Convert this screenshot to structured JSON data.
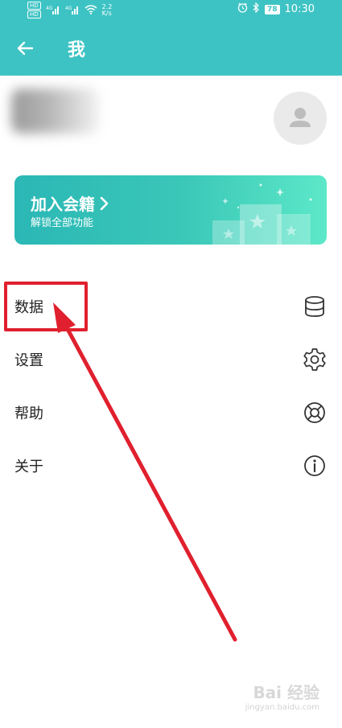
{
  "status_bar": {
    "net_label_1": "HD",
    "net_label_2": "HD",
    "sig_1": "4G",
    "sig_2": "4G",
    "speed_value": "2.2",
    "speed_unit": "K/s",
    "battery": "78",
    "time": "10:30"
  },
  "app_bar": {
    "title": "我",
    "back_icon": "arrow-left-icon"
  },
  "member_card": {
    "title": "加入会籍",
    "subtitle": "解锁全部功能"
  },
  "menu": {
    "items": [
      {
        "label": "数据",
        "icon": "database-icon"
      },
      {
        "label": "设置",
        "icon": "gear-icon"
      },
      {
        "label": "帮助",
        "icon": "lifebuoy-icon"
      },
      {
        "label": "关于",
        "icon": "info-icon"
      }
    ]
  },
  "watermark": {
    "brand": "Bai 经验",
    "url": "jingyan.baidu.com"
  },
  "colors": {
    "primary": "#3ec3c4",
    "annotation": "#e0202e"
  }
}
